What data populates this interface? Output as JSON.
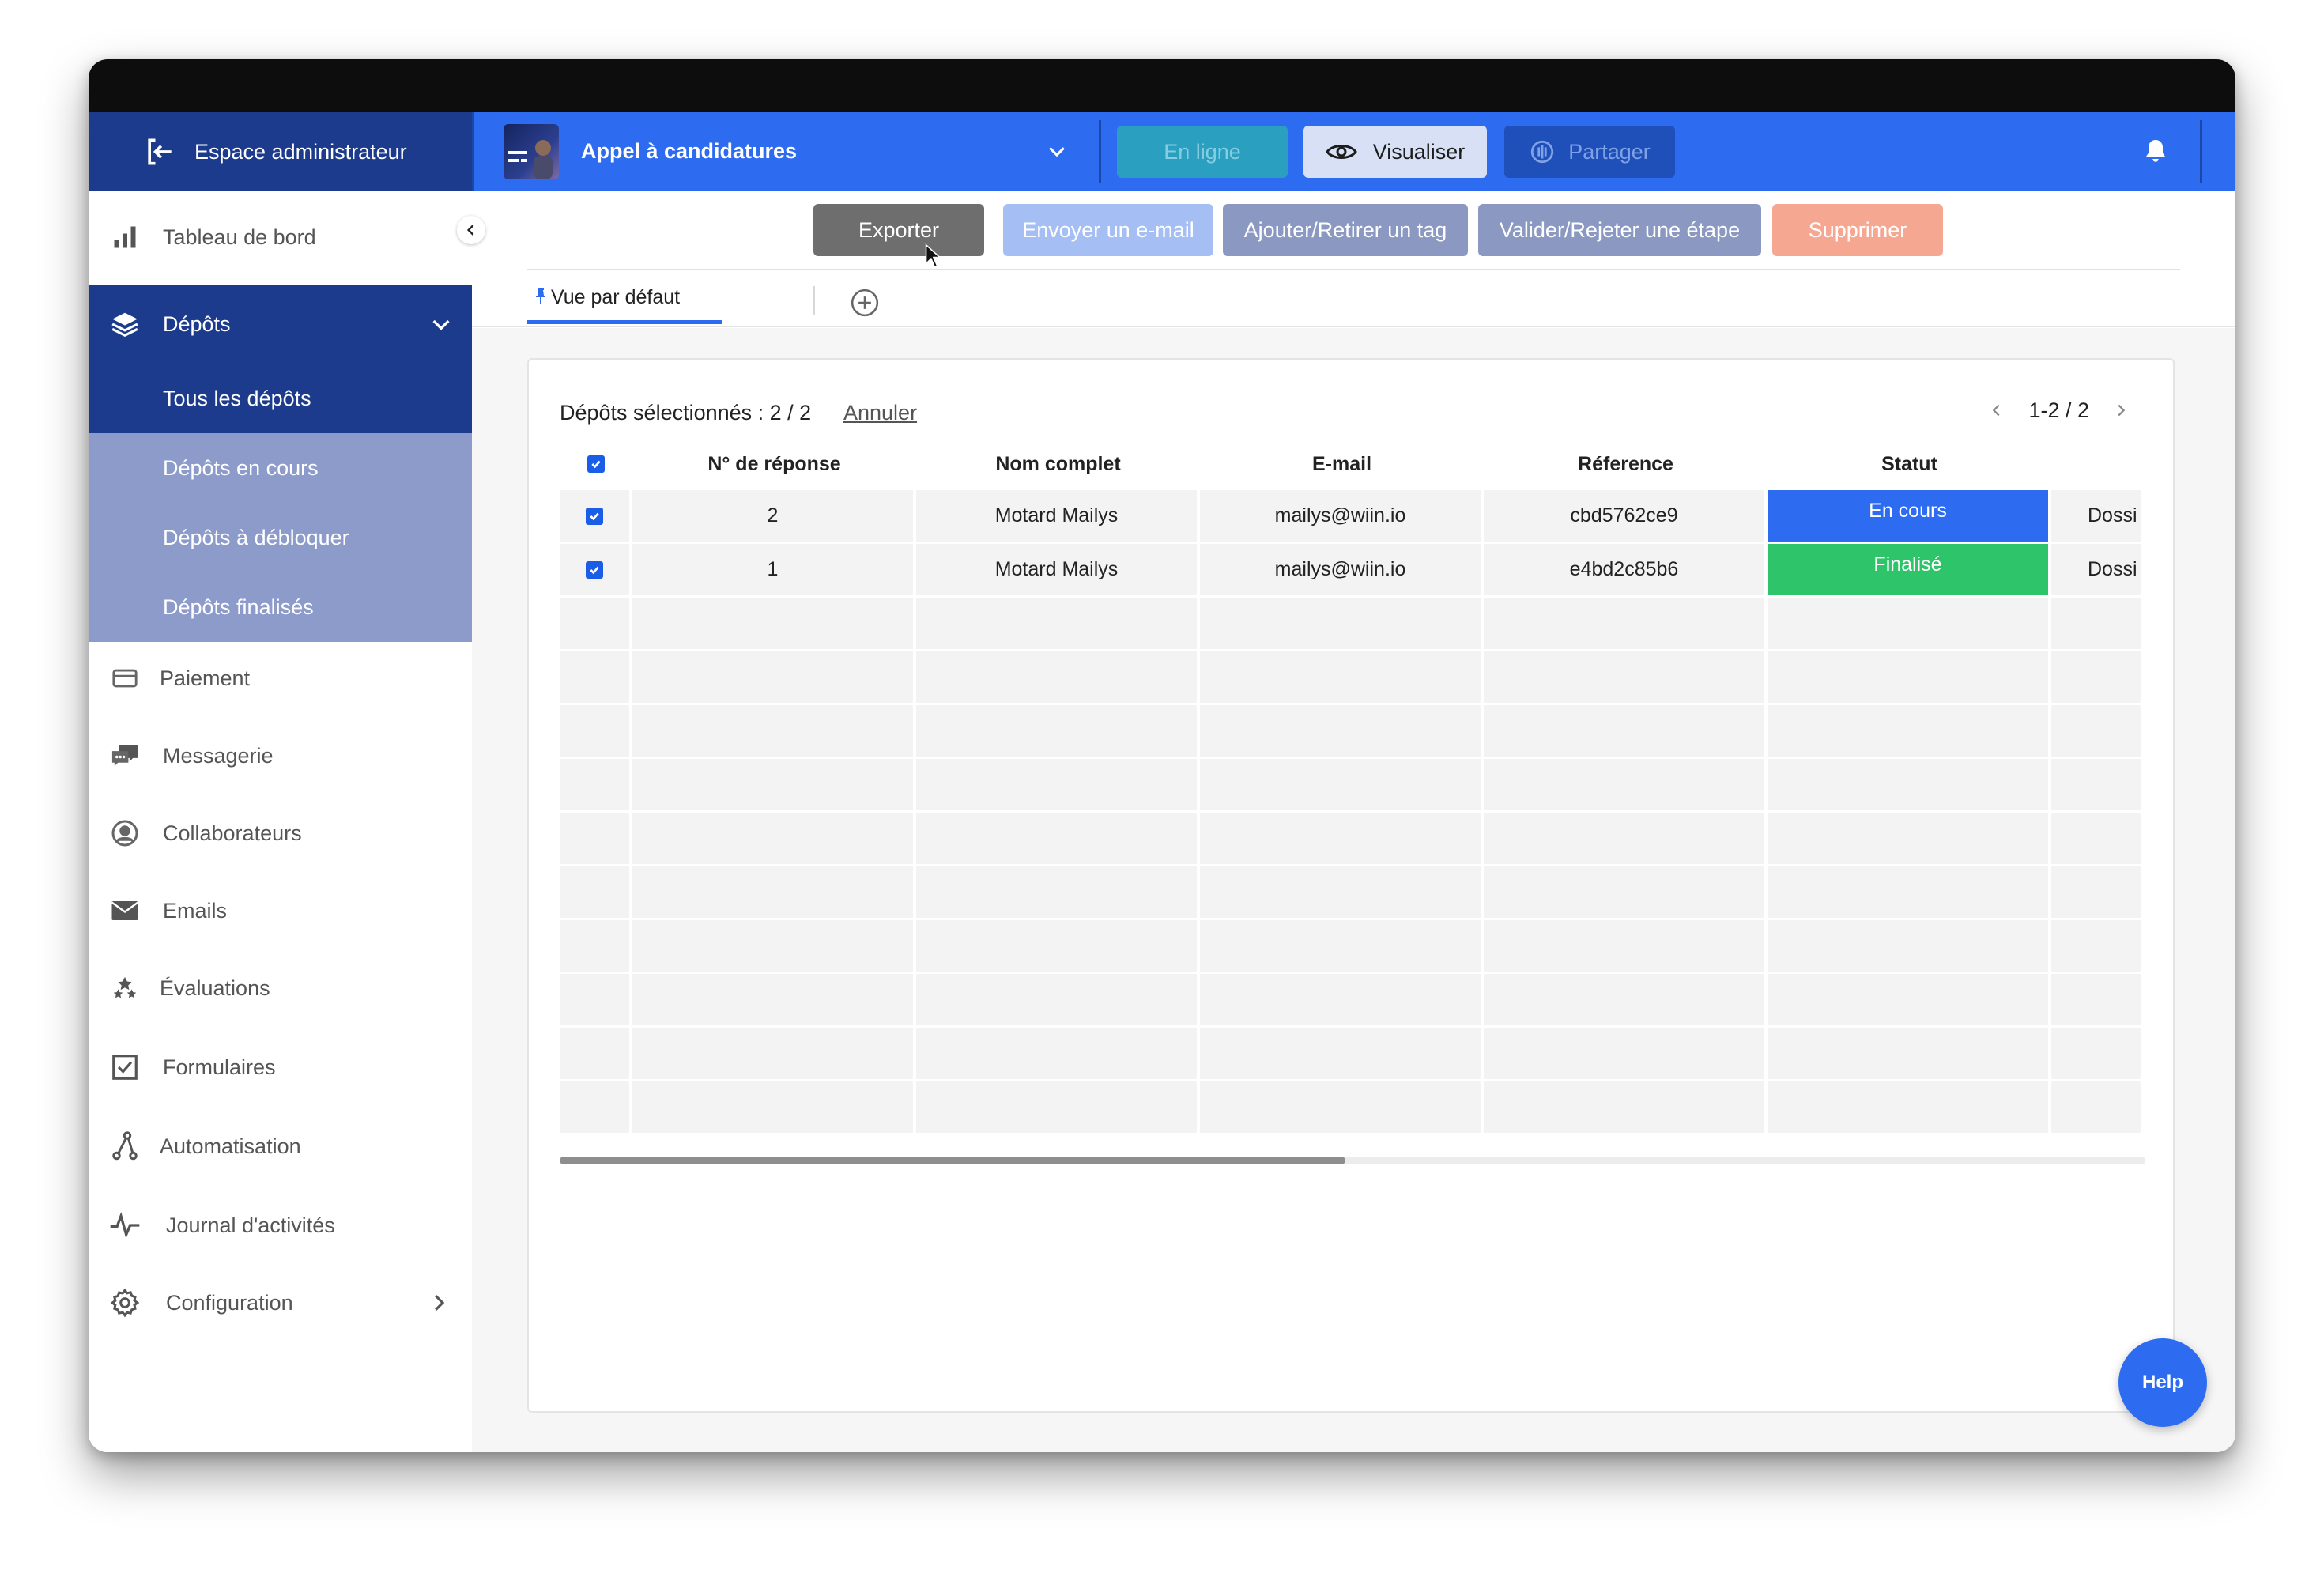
{
  "admin": {
    "label": "Espace administrateur",
    "icon": "exit-icon"
  },
  "topbar": {
    "form_title": "Appel à candidatures",
    "btn_online": "En ligne",
    "btn_view": "Visualiser",
    "btn_share": "Partager"
  },
  "sidebar": {
    "items": [
      {
        "label": "Tableau de bord",
        "icon": "bar-chart-icon"
      },
      {
        "label": "Dépôts",
        "icon": "layers-icon"
      },
      {
        "label": "Paiement",
        "icon": "card-icon"
      },
      {
        "label": "Messagerie",
        "icon": "chat-icon"
      },
      {
        "label": "Collaborateurs",
        "icon": "user-circle-icon"
      },
      {
        "label": "Emails",
        "icon": "envelope-icon"
      },
      {
        "label": "Évaluations",
        "icon": "stars-icon"
      },
      {
        "label": "Formulaires",
        "icon": "checkbox-icon"
      },
      {
        "label": "Automatisation",
        "icon": "automation-icon"
      },
      {
        "label": "Journal d'activités",
        "icon": "activity-icon"
      },
      {
        "label": "Configuration",
        "icon": "gear-icon"
      }
    ],
    "sub_items": [
      {
        "label": "Tous les dépôts"
      },
      {
        "label": "Dépôts en cours"
      },
      {
        "label": "Dépôts à débloquer"
      },
      {
        "label": "Dépôts finalisés"
      }
    ]
  },
  "actions": {
    "export": "Exporter",
    "send_email": "Envoyer un e-mail",
    "tag": "Ajouter/Retirer un tag",
    "validate": "Valider/Rejeter une étape",
    "delete": "Supprimer"
  },
  "tabs": {
    "default_view": "Vue par défaut"
  },
  "selection": {
    "text": "Dépôts sélectionnés : 2 / 2",
    "cancel": "Annuler"
  },
  "pager": {
    "text": "1-2 / 2"
  },
  "table": {
    "headers": [
      "N° de réponse",
      "Nom complet",
      "E-mail",
      "Réference",
      "Statut"
    ],
    "rows": [
      {
        "num": "2",
        "name": "Motard Mailys",
        "email": "mailys@wiin.io",
        "ref": "cbd5762ce9",
        "status": "En cours",
        "extra": "Dossi"
      },
      {
        "num": "1",
        "name": "Motard Mailys",
        "email": "mailys@wiin.io",
        "ref": "e4bd2c85b6",
        "status": "Finalisé",
        "extra": "Dossi"
      }
    ]
  },
  "help": "Help",
  "colors": {
    "accent": "#2d6cf0",
    "navy": "#1d3b8c",
    "status_in_progress": "#2d6cf0",
    "status_done": "#2ec46a"
  }
}
